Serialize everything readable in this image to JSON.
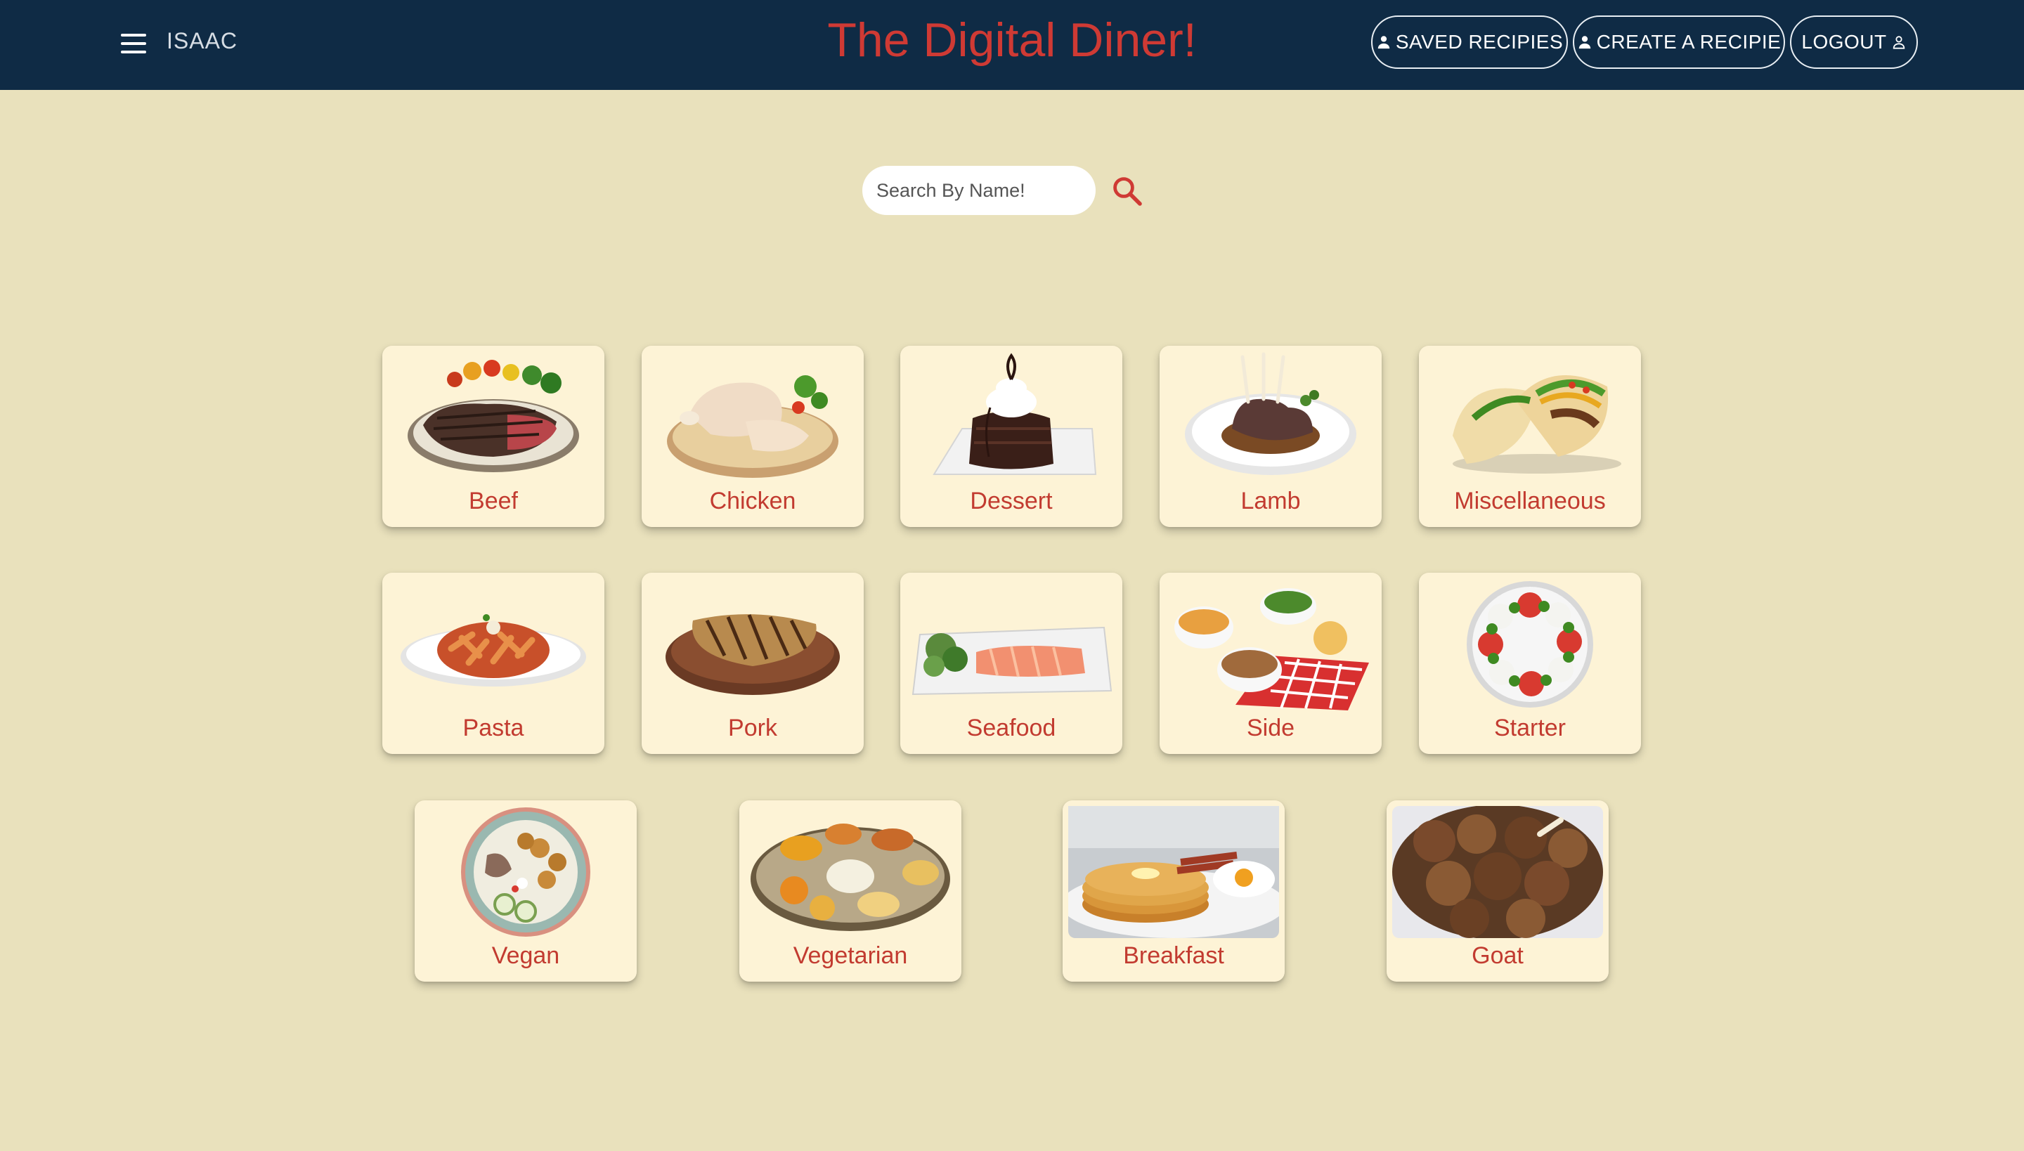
{
  "header": {
    "user_name": "ISAAC",
    "site_title": "The Digital Diner!",
    "nav": {
      "saved_recipes": "SAVED RECIPIES",
      "create_recipe": "CREATE A RECIPIE",
      "logout": "LOGOUT"
    }
  },
  "search": {
    "placeholder": "Search By Name!",
    "value": ""
  },
  "categories": [
    {
      "label": "Beef"
    },
    {
      "label": "Chicken"
    },
    {
      "label": "Dessert"
    },
    {
      "label": "Lamb"
    },
    {
      "label": "Miscellaneous"
    },
    {
      "label": "Pasta"
    },
    {
      "label": "Pork"
    },
    {
      "label": "Seafood"
    },
    {
      "label": "Side"
    },
    {
      "label": "Starter"
    },
    {
      "label": "Vegan"
    },
    {
      "label": "Vegetarian"
    },
    {
      "label": "Breakfast"
    },
    {
      "label": "Goat"
    }
  ],
  "colors": {
    "header_bg": "#0f2b45",
    "page_bg": "#e9e1bc",
    "card_bg": "#fdf3d6",
    "accent_red": "#cf3a34"
  },
  "icons": {
    "menu": "menu-icon",
    "nav_person": "person-icon",
    "search": "search-icon"
  }
}
